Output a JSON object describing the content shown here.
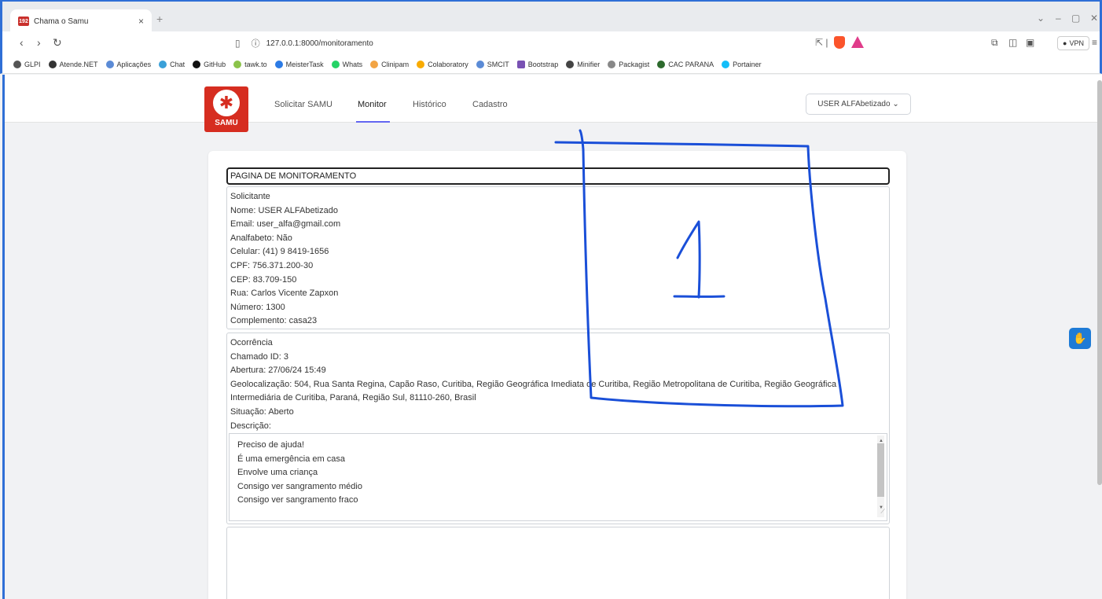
{
  "browser": {
    "tab_title": "Chama o Samu",
    "tab_favicon": "192",
    "tab_close": "×",
    "new_tab": "+",
    "url": "127.0.0.1:8000/monitoramento",
    "vpn_label": "VPN",
    "bookmarks": [
      "GLPI",
      "Atende.NET",
      "Aplicações",
      "Chat",
      "GitHub",
      "tawk.to",
      "MeisterTask",
      "Whats",
      "Clinipam",
      "Colaboratory",
      "SMCIT",
      "Bootstrap",
      "Minifier",
      "Packagist",
      "CAC PARANA",
      "Portainer"
    ],
    "accent_color": "#2f6fd6"
  },
  "nav": {
    "logo_text": "SAMU",
    "links": [
      "Solicitar SAMU",
      "Monitor",
      "Histórico",
      "Cadastro"
    ],
    "active": "Monitor",
    "user_button": "USER ALFAbetizado ⌄"
  },
  "main": {
    "title": "PAGINA DE MONITORAMENTO",
    "solicitante": {
      "heading": "Solicitante",
      "nome": "Nome: USER ALFAbetizado",
      "email": "Email: user_alfa@gmail.com",
      "analfabeto": "Analfabeto: Não",
      "celular": "Celular: (41) 9 8419-1656",
      "cpf": "CPF: 756.371.200-30",
      "cep": "CEP: 83.709-150",
      "rua": "Rua: Carlos Vicente Zapxon",
      "numero": "Número: 1300",
      "complemento": "Complemento: casa23"
    },
    "ocorrencia": {
      "heading": "Ocorrência",
      "chamado": "Chamado ID: 3",
      "abertura": "Abertura: 27/06/24 15:49",
      "geo_line1": "Geolocalização: 504, Rua Santa Regina, Capão Raso, Curitiba, Região Geográfica Imediata de Curitiba, Região Metropolitana de Curitiba, Região Geográfica",
      "geo_line2": "Intermediária de Curitiba, Paraná, Região Sul, 81110-260, Brasil",
      "situacao": "Situação: Aberto",
      "descricao_label": "Descrição:",
      "descricao_lines": [
        "Preciso de ajuda!",
        "É uma emergência em casa",
        "Envolve uma criança",
        "Consigo ver sangramento médio",
        "Consigo ver sangramento fraco"
      ]
    }
  },
  "annotation": {
    "label": "1",
    "color": "#1a4fd8"
  }
}
